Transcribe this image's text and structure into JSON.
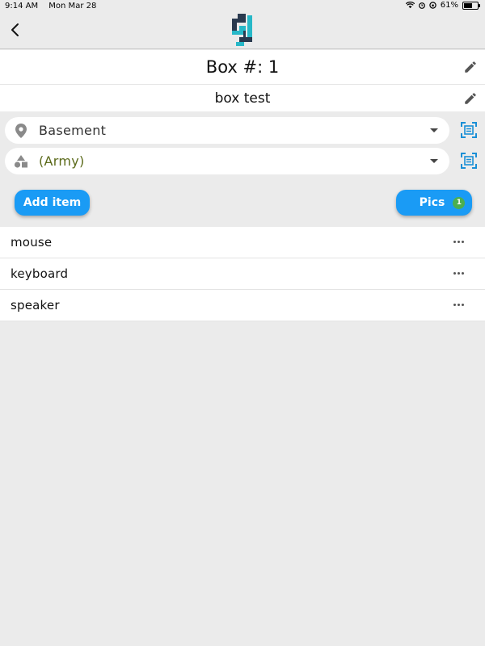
{
  "status_bar": {
    "time": "9:14 AM",
    "date": "Mon Mar 28",
    "battery": "61%"
  },
  "header": {
    "back_icon": "chevron-left-icon",
    "logo_icon": "app-logo"
  },
  "box": {
    "title": "Box #: 1",
    "name": "box test"
  },
  "location_select": {
    "value": "Basement",
    "icon": "location-pin-icon",
    "value_color": "#333333"
  },
  "category_select": {
    "value": "(Army)",
    "icon": "shapes-icon",
    "value_color": "#5b6a1a"
  },
  "actions": {
    "add_item_label": "Add item",
    "pics_label": "Pics",
    "pics_count": "1"
  },
  "items": [
    {
      "name": "mouse"
    },
    {
      "name": "keyboard"
    },
    {
      "name": "speaker"
    }
  ],
  "colors": {
    "accent": "#1a9bf5",
    "badge": "#4caf50",
    "scan_icon": "#1a8fd6"
  }
}
